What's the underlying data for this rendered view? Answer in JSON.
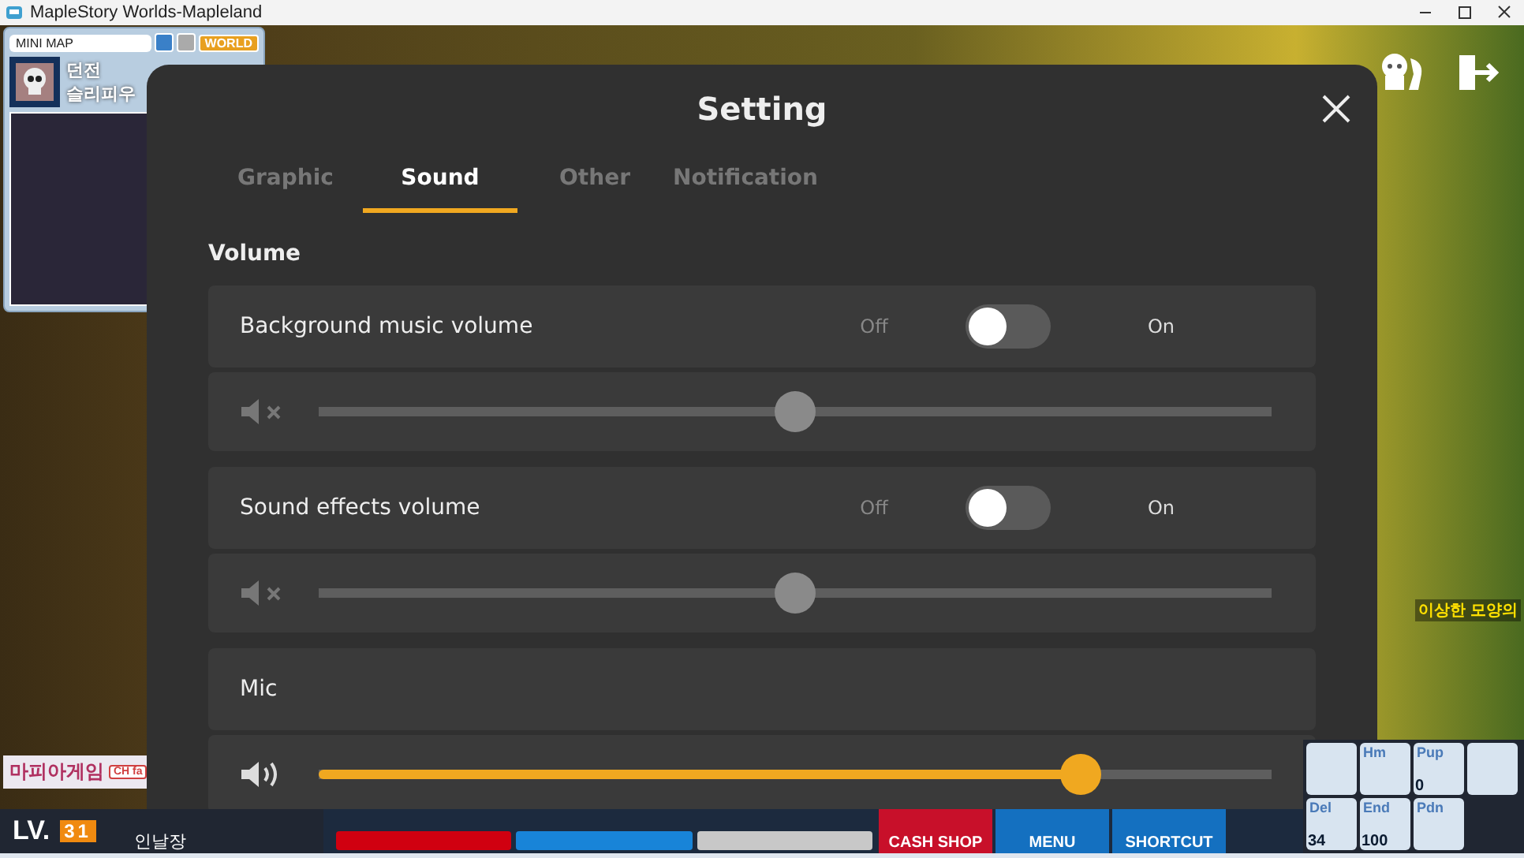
{
  "window": {
    "title": "MapleStory Worlds-Mapleland"
  },
  "minimap": {
    "title": "MINI MAP",
    "world_button": "WORLD",
    "region": "던전",
    "map_name": "슬리피우"
  },
  "game_labels": {
    "channel_tag": "마피아게임",
    "channel_badge": "CH fa",
    "npc_name": "이상한 모양의"
  },
  "settings": {
    "title": "Setting",
    "tabs": [
      {
        "label": "Graphic",
        "selected": false
      },
      {
        "label": "Sound",
        "selected": true
      },
      {
        "label": "Other",
        "selected": false
      },
      {
        "label": "Notification",
        "selected": false
      }
    ],
    "section": "Volume",
    "groups": [
      {
        "label": "Background music volume",
        "toggle": {
          "off_label": "Off",
          "on_label": "On",
          "on": false
        },
        "muted": true,
        "level": 0.5
      },
      {
        "label": "Sound effects volume",
        "toggle": {
          "off_label": "Off",
          "on_label": "On",
          "on": false
        },
        "muted": true,
        "level": 0.5
      },
      {
        "label": "Mic",
        "muted": false,
        "level": 0.8
      }
    ]
  },
  "hud": {
    "level_label": "LV.",
    "level": "31",
    "name": "인날장",
    "buttons": [
      "CASH SHOP",
      "MENU",
      "SHORTCUT"
    ],
    "quickslots": [
      {
        "key": "Hm"
      },
      {
        "key": "Pup",
        "count": "0"
      },
      {
        "key": "Del",
        "count": "34"
      },
      {
        "key": "End",
        "count": "100"
      },
      {
        "key": "Pdn"
      }
    ]
  }
}
